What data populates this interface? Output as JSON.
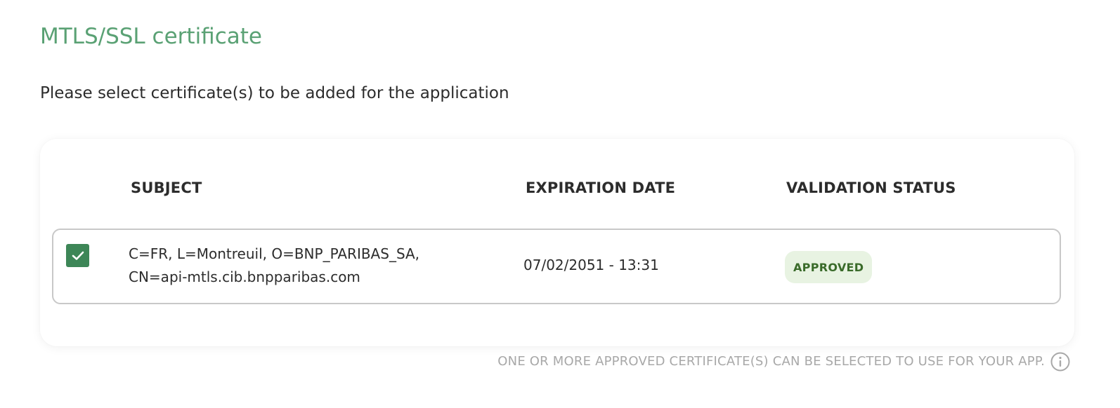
{
  "section": {
    "title": "MTLS/SSL certificate",
    "subtitle": "Please select certificate(s) to be added for the application"
  },
  "table": {
    "headers": {
      "subject": "SUBJECT",
      "expiration": "EXPIRATION DATE",
      "status": "VALIDATION STATUS"
    },
    "rows": [
      {
        "selected": true,
        "subject": "C=FR, L=Montreuil, O=BNP_PARIBAS_SA, CN=api-mtls.cib.bnpparibas.com",
        "expiration": "07/02/2051 - 13:31",
        "status": "APPROVED"
      }
    ]
  },
  "footnote": {
    "text": "ONE OR MORE APPROVED CERTIFICATE(S) CAN BE SELECTED TO USE FOR YOUR APP.",
    "icon": "info-icon"
  },
  "colors": {
    "accent": "#5aa174",
    "checkbox": "#3d8657",
    "badge_bg": "#e8f3e2",
    "badge_text": "#3a6b2a"
  }
}
